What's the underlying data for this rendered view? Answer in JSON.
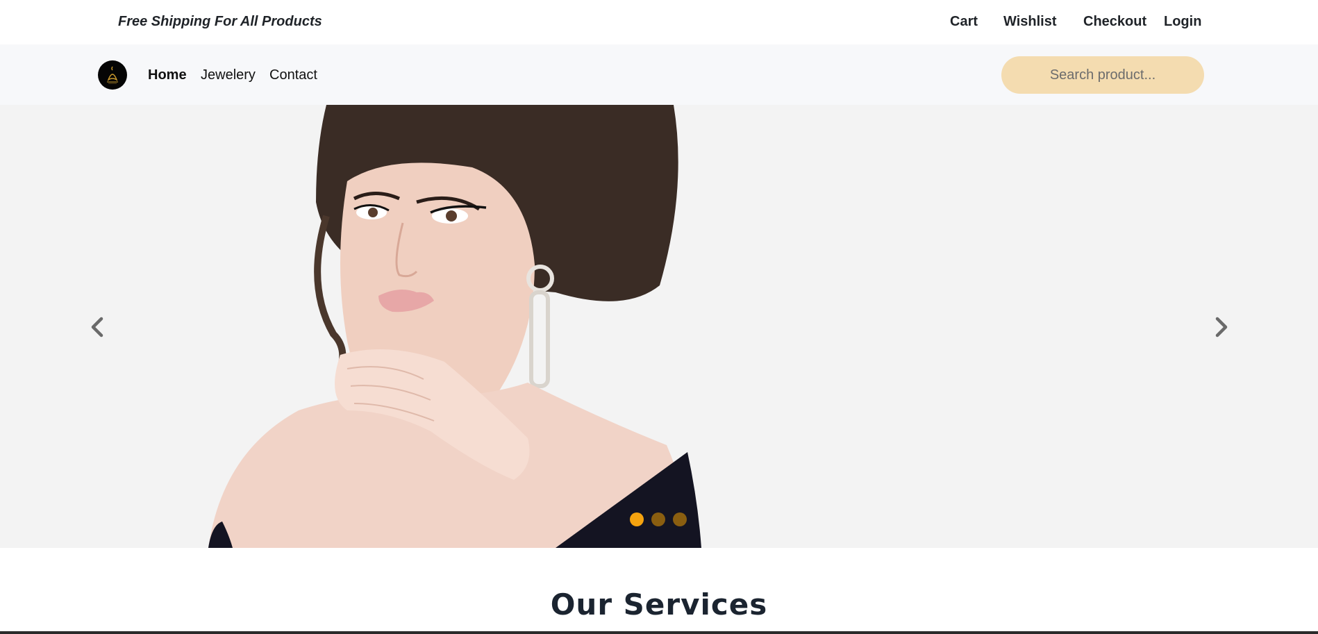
{
  "topbar": {
    "promo": "Free Shipping For All Products",
    "links": [
      "Cart",
      "Wishlist",
      "Checkout",
      "Login"
    ]
  },
  "navbar": {
    "logo_icon": "jewelry-brand-logo-icon",
    "links": [
      "Home",
      "Jewelery",
      "Contact"
    ],
    "active": "Home",
    "search_placeholder": "Search product..."
  },
  "hero": {
    "prev_icon": "chevron-left-icon",
    "next_icon": "chevron-right-icon",
    "slide_count": 3,
    "active_slide": 1,
    "colors": {
      "dot_active": "#f5a30f",
      "dot_inactive": "#8a5e10",
      "background": "#f3f3f3"
    }
  },
  "services": {
    "title": "Our Services"
  }
}
